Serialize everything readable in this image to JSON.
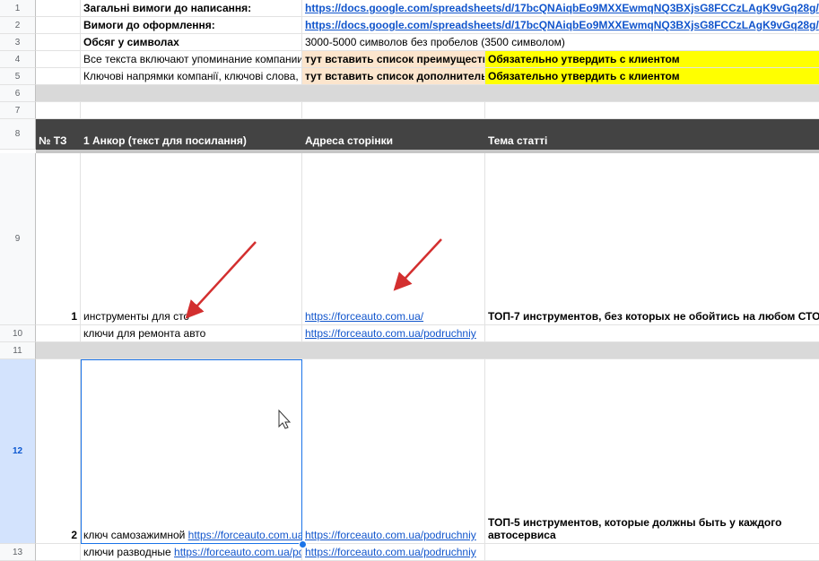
{
  "rows": {
    "r1": "1",
    "r2": "2",
    "r3": "3",
    "r4": "4",
    "r5": "5",
    "r6": "6",
    "r7": "7",
    "r8": "8",
    "r9": "9",
    "r10": "10",
    "r11": "11",
    "r12": "12",
    "r13": "13"
  },
  "sheet": {
    "r1b": "Загальні вимоги до написання:",
    "r1c": "https://docs.google.com/spreadsheets/d/17bcQNAiqbEo9MXXEwmqNQ3BXjsG8FCCzLAgK9vGq28g/",
    "r2b": "Вимоги до оформлення:",
    "r2c": "https://docs.google.com/spreadsheets/d/17bcQNAiqbEo9MXXEwmqNQ3BXjsG8FCCzLAgK9vGq28g/",
    "r3b": "Обсяг у символах",
    "r3c": "3000-5000 символов без пробелов (3500 символом)",
    "r4b": "Все текста включают упоминание компании",
    "r4c": "тут вставить список преимуществ",
    "r4d": "Обязательно утвердить с клиентом",
    "r5b": "Ключові напрямки компанії, ключові слова,",
    "r5c": "тут вставить список дополнительных",
    "r5d": "Обязательно утвердить с клиентом",
    "h_a": "№ ТЗ",
    "h_b": "1 Анкор (текст для посилання)",
    "h_c": "Адреса сторінки",
    "h_d": "Тема статті",
    "r9a": "1",
    "r9b": "инструменты для сто",
    "r9c": "https://forceauto.com.ua/",
    "r9d": "ТОП-7 инструментов, без которых не обойтись на любом СТО",
    "r10b": "ключи для ремонта авто",
    "r10c": "https://forceauto.com.ua/podruchniy",
    "r12a": "2",
    "r12b_text": "ключ самозажимной ",
    "r12b_link": "https://forceauto.com.ua",
    "r12c": "https://forceauto.com.ua/podruchniy",
    "r12d_1": "ТОП-5 инструментов, которые должны быть у каждого",
    "r12d_2": "автосервиса",
    "r13b_text": "ключи разводные ",
    "r13b_link": "https://forceauto.com.ua/po",
    "r13c": "https://forceauto.com.ua/podruchniy"
  },
  "colors": {
    "header_bg": "#434343",
    "selection": "#1a73e8",
    "arrow": "#d32f2f",
    "link": "#1155cc"
  }
}
